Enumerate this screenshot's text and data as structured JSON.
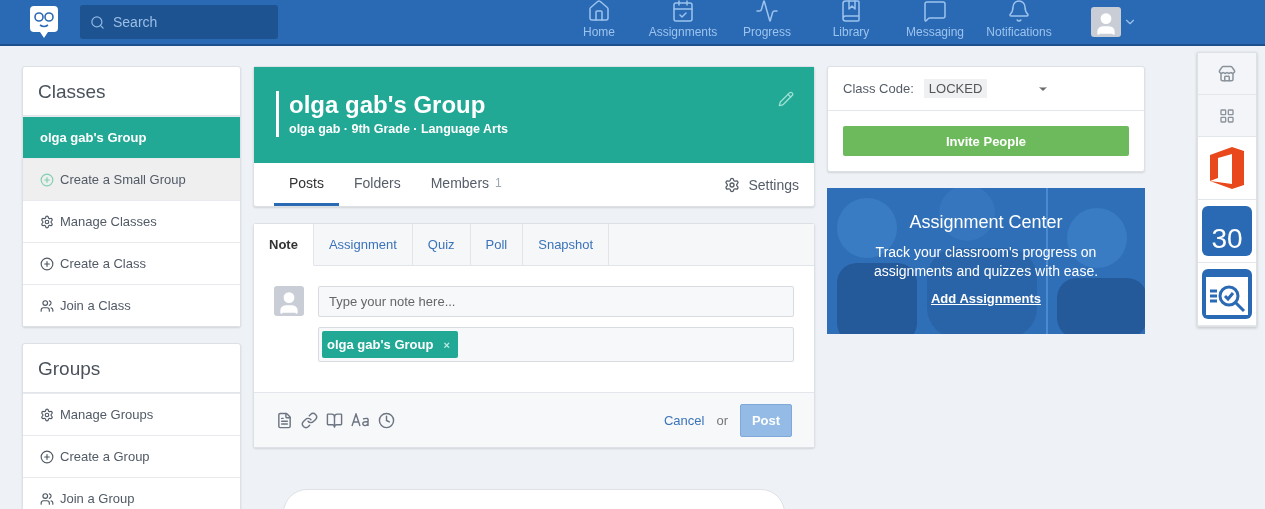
{
  "topbar": {
    "search": {
      "placeholder": "Search"
    },
    "nav": [
      {
        "label": "Home"
      },
      {
        "label": "Assignments"
      },
      {
        "label": "Progress"
      },
      {
        "label": "Library"
      },
      {
        "label": "Messaging"
      },
      {
        "label": "Notifications"
      }
    ]
  },
  "classes": {
    "title": "Classes",
    "items": [
      {
        "label": "olga gab's Group",
        "kind": "group",
        "selected": true
      },
      {
        "label": "Create a Small Group",
        "kind": "subgroup",
        "selected": false
      },
      {
        "label": "Manage Classes",
        "kind": "manage",
        "selected": false
      },
      {
        "label": "Create a Class",
        "kind": "create",
        "selected": false
      },
      {
        "label": "Join a Class",
        "kind": "join",
        "selected": false
      }
    ]
  },
  "groups": {
    "title": "Groups",
    "items": [
      {
        "label": "Manage Groups",
        "kind": "manage",
        "selected": false
      },
      {
        "label": "Create a Group",
        "kind": "create",
        "selected": false
      },
      {
        "label": "Join a Group",
        "kind": "join",
        "selected": false
      }
    ]
  },
  "group_header": {
    "title": "olga gab's Group",
    "subtitle": "olga gab · 9th Grade · Language Arts"
  },
  "group_tabs": [
    {
      "label": "Posts",
      "selected": true
    },
    {
      "label": "Folders",
      "selected": false
    },
    {
      "label": "Members",
      "count": "1",
      "selected": false
    }
  ],
  "settings": "Settings",
  "composer": {
    "tabs": [
      {
        "label": "Note",
        "selected": true
      },
      {
        "label": "Assignment",
        "selected": false
      },
      {
        "label": "Quiz",
        "selected": false
      },
      {
        "label": "Poll",
        "selected": false
      },
      {
        "label": "Snapshot",
        "selected": false
      }
    ],
    "placeholder": "Type your note here...",
    "recipient": "olga gab's Group",
    "remove": "×",
    "cancel": "Cancel",
    "or": "or",
    "post": {
      "label": "Post",
      "disabled": true
    }
  },
  "class_code": {
    "label": "Class Code:",
    "value": "LOCKED",
    "invite": "Invite People"
  },
  "promo": {
    "title": "Assignment Center",
    "text": "Track your classroom's progress on assignments and quizzes with ease.",
    "link": "Add Assignments"
  },
  "dock": [
    {
      "kind": "store"
    },
    {
      "kind": "apps"
    },
    {
      "kind": "office"
    },
    {
      "kind": "calendar",
      "text": "30"
    },
    {
      "kind": "review"
    }
  ]
}
